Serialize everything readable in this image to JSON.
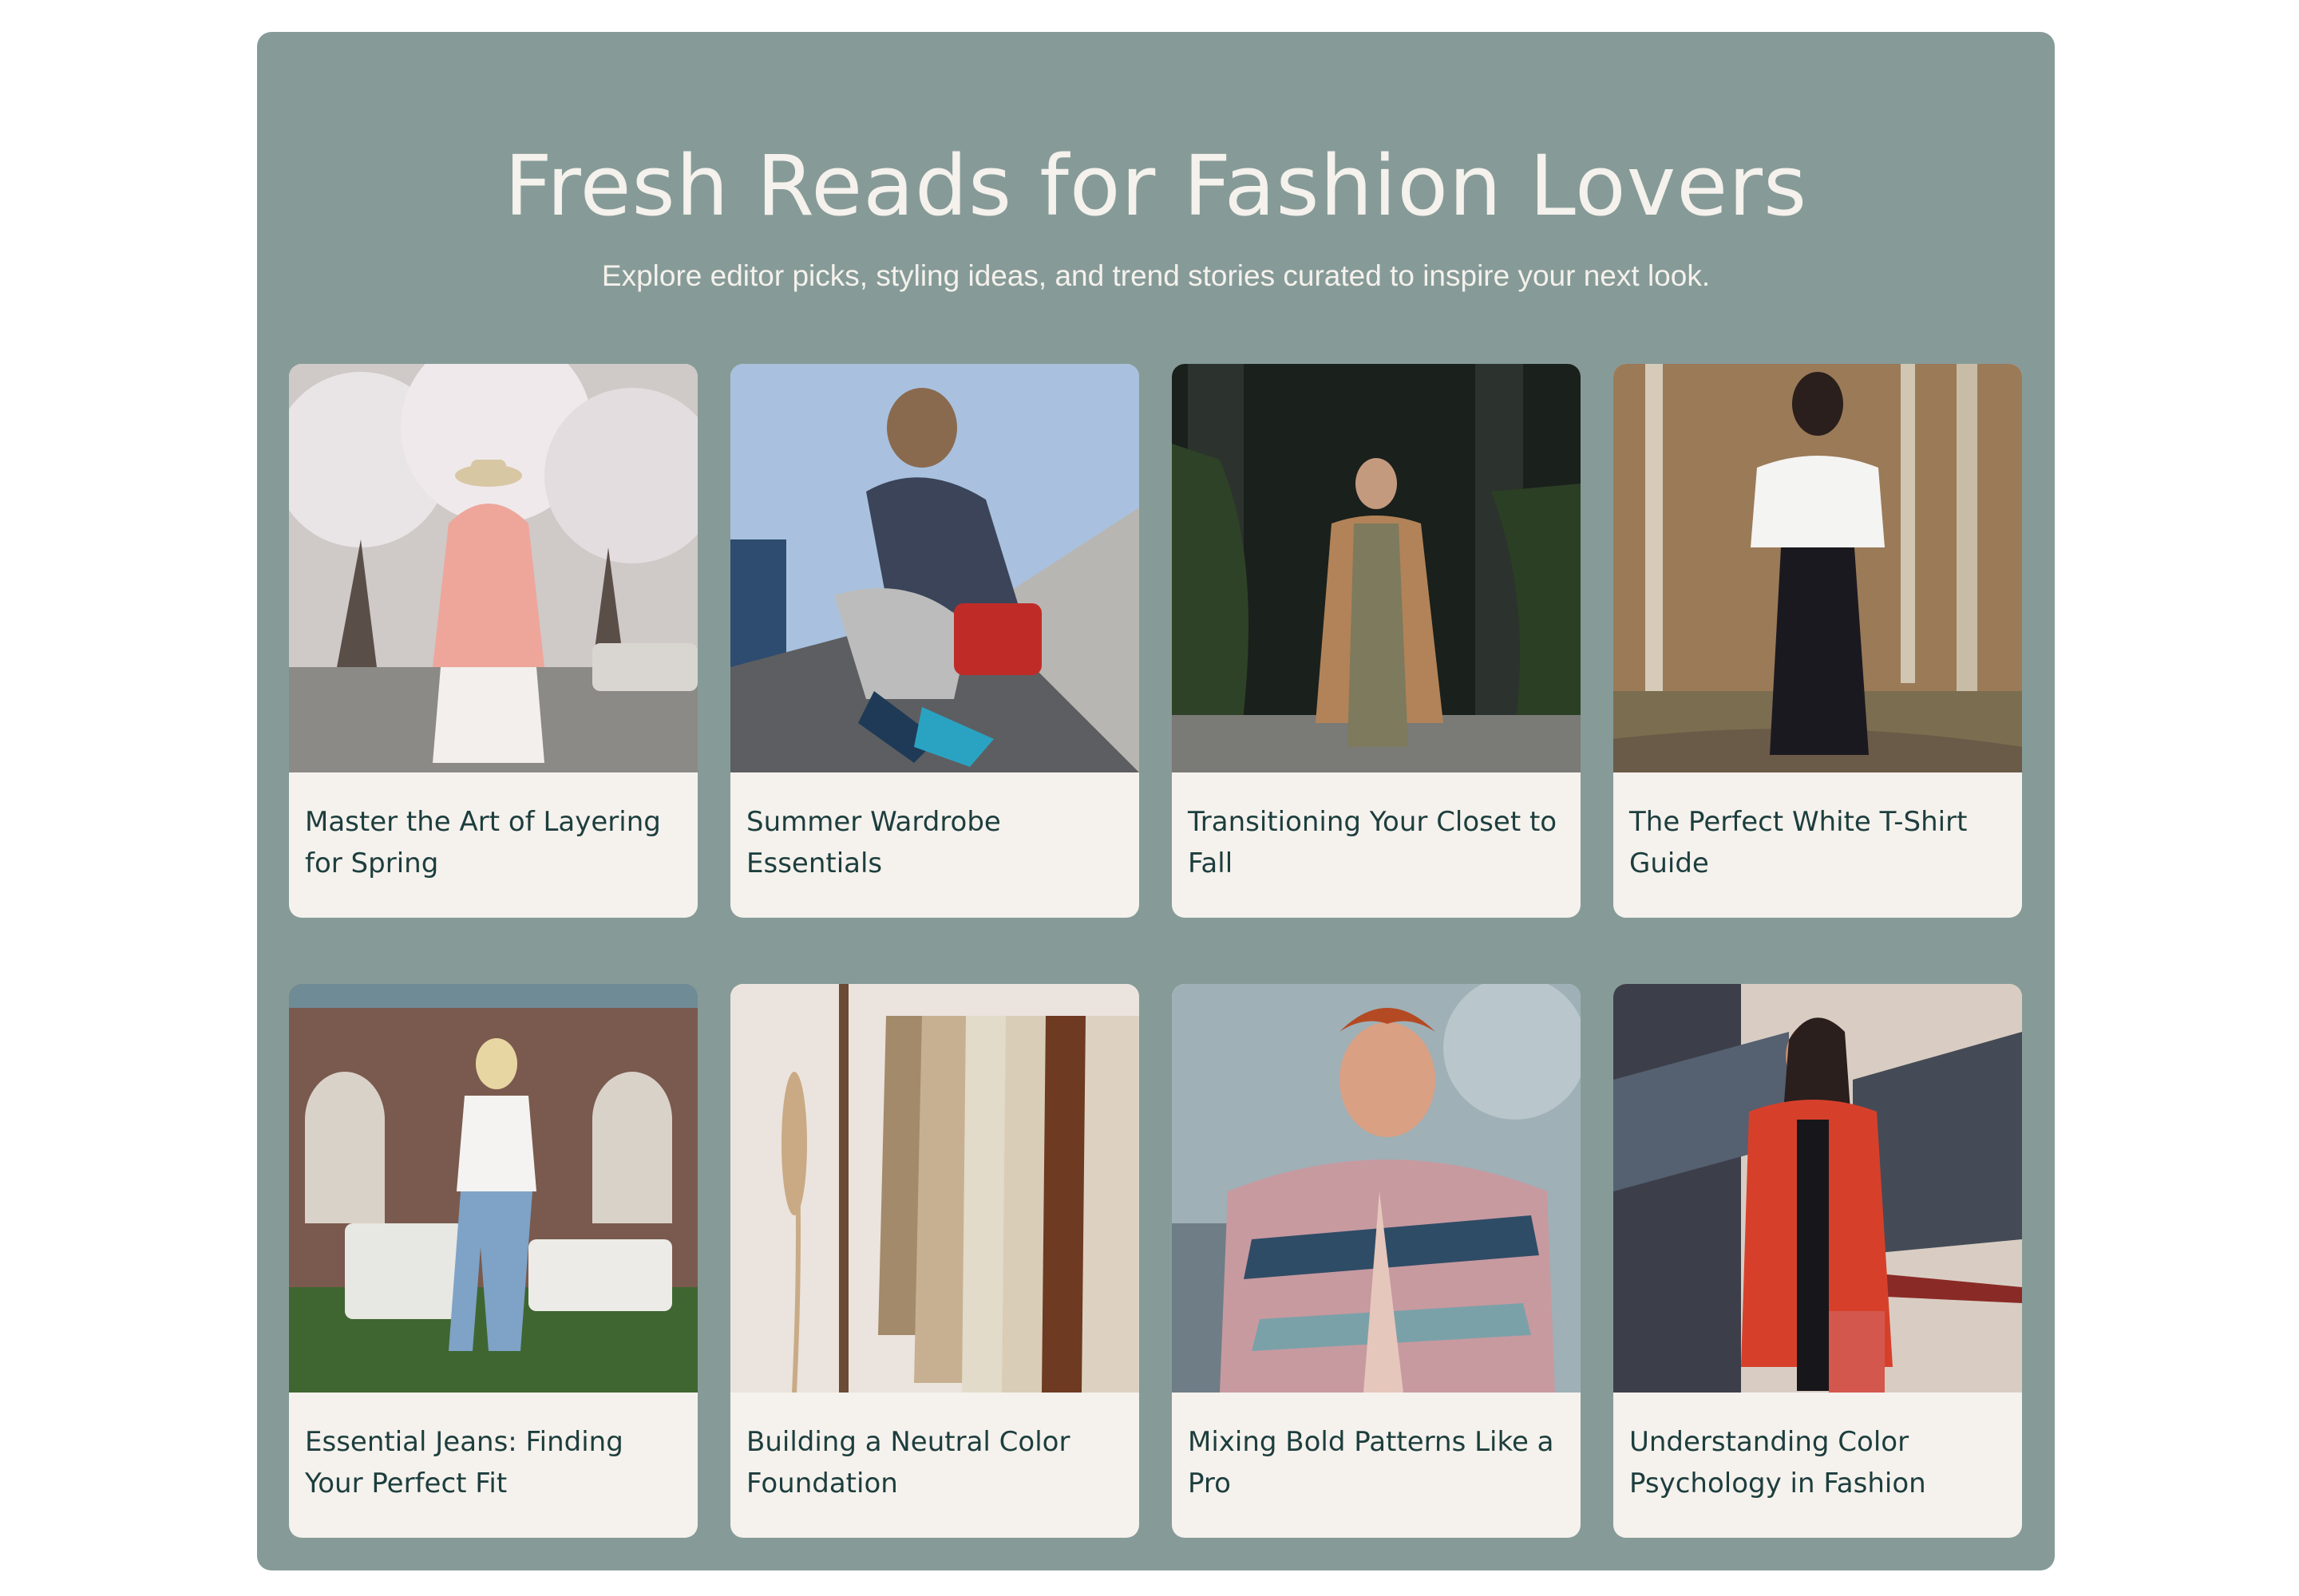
{
  "section": {
    "title": "Fresh Reads for Fashion Lovers",
    "subtitle": "Explore editor picks, styling ideas, and trend stories curated to inspire your next look."
  },
  "articles": [
    {
      "title": "Master the Art of Layering for Spring"
    },
    {
      "title": "Summer Wardrobe Essentials"
    },
    {
      "title": "Transitioning Your Closet to Fall"
    },
    {
      "title": "The Perfect White T-Shirt Guide"
    },
    {
      "title": "Essential Jeans: Finding Your Perfect Fit"
    },
    {
      "title": "Building a Neutral Color Foundation"
    },
    {
      "title": "Mixing Bold Patterns Like a Pro"
    },
    {
      "title": "Understanding Color Psychology in Fashion"
    }
  ],
  "colors": {
    "panel": "#869b98",
    "card": "#f5f1ed",
    "heading_text": "#f5f1ec",
    "card_title_text": "#1c3e3d"
  }
}
